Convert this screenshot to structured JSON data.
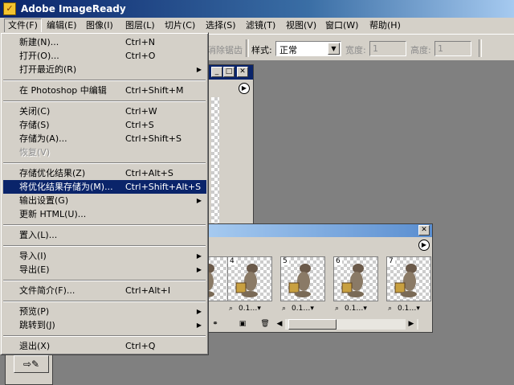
{
  "app": {
    "title": "Adobe ImageReady",
    "icon": "imageready-logo-icon"
  },
  "menubar": [
    {
      "label": "文件(F)",
      "name": "menu-file",
      "active": true
    },
    {
      "label": "编辑(E)",
      "name": "menu-edit"
    },
    {
      "label": "图像(I)",
      "name": "menu-image"
    },
    {
      "label": "图层(L)",
      "name": "menu-layer"
    },
    {
      "label": "切片(C)",
      "name": "menu-slices"
    },
    {
      "label": "选择(S)",
      "name": "menu-select"
    },
    {
      "label": "滤镜(T)",
      "name": "menu-filter"
    },
    {
      "label": "视图(V)",
      "name": "menu-view"
    },
    {
      "label": "窗口(W)",
      "name": "menu-window"
    },
    {
      "label": "帮助(H)",
      "name": "menu-help"
    }
  ],
  "options_bar": {
    "antialias_label": "消除锯齿",
    "style_label": "样式:",
    "style_value": "正常",
    "width_label": "宽度:",
    "width_value": "1",
    "height_label": "高度:",
    "height_value": "1"
  },
  "file_menu": {
    "items": [
      {
        "label": "新建(N)...",
        "shortcut": "Ctrl+N"
      },
      {
        "label": "打开(O)...",
        "shortcut": "Ctrl+O"
      },
      {
        "label": "打开最近的(R)",
        "submenu": true
      },
      {
        "separator": true
      },
      {
        "label": "在 Photoshop 中编辑",
        "shortcut": "Ctrl+Shift+M"
      },
      {
        "separator": true
      },
      {
        "label": "关闭(C)",
        "shortcut": "Ctrl+W"
      },
      {
        "label": "存储(S)",
        "shortcut": "Ctrl+S"
      },
      {
        "label": "存储为(A)...",
        "shortcut": "Ctrl+Shift+S"
      },
      {
        "label": "恢复(V)",
        "disabled": true
      },
      {
        "separator": true
      },
      {
        "label": "存储优化结果(Z)",
        "shortcut": "Ctrl+Alt+S"
      },
      {
        "label": "将优化结果存储为(M)...",
        "shortcut": "Ctrl+Shift+Alt+S",
        "highlighted": true
      },
      {
        "label": "输出设置(G)",
        "submenu": true
      },
      {
        "label": "更新 HTML(U)..."
      },
      {
        "separator": true
      },
      {
        "label": "置入(L)..."
      },
      {
        "separator": true
      },
      {
        "label": "导入(I)",
        "submenu": true
      },
      {
        "label": "导出(E)",
        "submenu": true
      },
      {
        "separator": true
      },
      {
        "label": "文件简介(F)...",
        "shortcut": "Ctrl+Alt+I"
      },
      {
        "separator": true
      },
      {
        "label": "预览(P)",
        "submenu": true
      },
      {
        "label": "跳转到(J)",
        "submenu": true
      },
      {
        "separator": true
      },
      {
        "label": "退出(X)",
        "shortcut": "Ctrl+Q"
      }
    ]
  },
  "animation_palette": {
    "frames": [
      {
        "number": "",
        "delay": ""
      },
      {
        "number": "4",
        "delay": "0.1"
      },
      {
        "number": "5",
        "delay": "0.1"
      },
      {
        "number": "6",
        "delay": "0.1"
      },
      {
        "number": "7",
        "delay": "0.1"
      }
    ]
  },
  "colors": {
    "titlebar": "#0a246a",
    "highlight": "#0a246a",
    "face": "#d4d0c8",
    "desktop": "#808080"
  }
}
